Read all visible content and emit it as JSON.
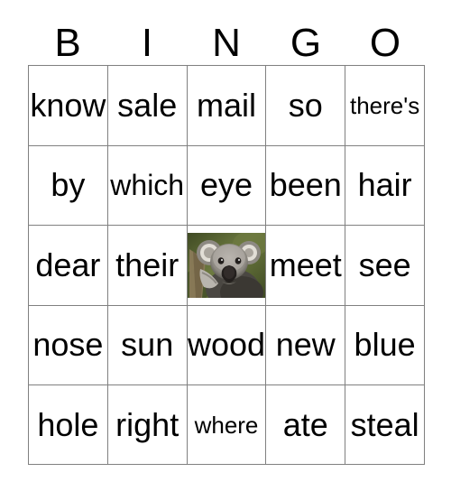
{
  "card": {
    "header_letters": [
      "B",
      "I",
      "N",
      "G",
      "O"
    ],
    "rows": [
      [
        {
          "text": "know",
          "size": "lg"
        },
        {
          "text": "sale",
          "size": "lg"
        },
        {
          "text": "mail",
          "size": "lg"
        },
        {
          "text": "so",
          "size": "lg"
        },
        {
          "text": "there's",
          "size": "sm"
        }
      ],
      [
        {
          "text": "by",
          "size": "lg"
        },
        {
          "text": "which",
          "size": "md"
        },
        {
          "text": "eye",
          "size": "lg"
        },
        {
          "text": "been",
          "size": "lg"
        },
        {
          "text": "hair",
          "size": "lg"
        }
      ],
      [
        {
          "text": "dear",
          "size": "lg"
        },
        {
          "text": "their",
          "size": "lg"
        },
        {
          "type": "image",
          "image": "koala-photo",
          "text": ""
        },
        {
          "text": "meet",
          "size": "lg"
        },
        {
          "text": "see",
          "size": "lg"
        }
      ],
      [
        {
          "text": "nose",
          "size": "lg"
        },
        {
          "text": "sun",
          "size": "lg"
        },
        {
          "text": "wood",
          "size": "lg"
        },
        {
          "text": "new",
          "size": "lg"
        },
        {
          "text": "blue",
          "size": "lg"
        }
      ],
      [
        {
          "text": "hole",
          "size": "lg"
        },
        {
          "text": "right",
          "size": "lg"
        },
        {
          "text": "where",
          "size": "sm"
        },
        {
          "text": "ate",
          "size": "lg"
        },
        {
          "text": "steal",
          "size": "lg"
        }
      ]
    ]
  },
  "colors": {
    "background": "#ffffff",
    "text": "#000000",
    "border": "#808080",
    "koala_fur_light": "#b9b5ae",
    "koala_fur_mid": "#8d8982",
    "koala_fur_dark": "#4a4742",
    "koala_nose": "#231f1d",
    "koala_ear_tuft": "#e2ded6",
    "foliage_green": "#6d7a40",
    "foliage_dark": "#3f4a23",
    "branch_tan": "#8a7a58"
  }
}
